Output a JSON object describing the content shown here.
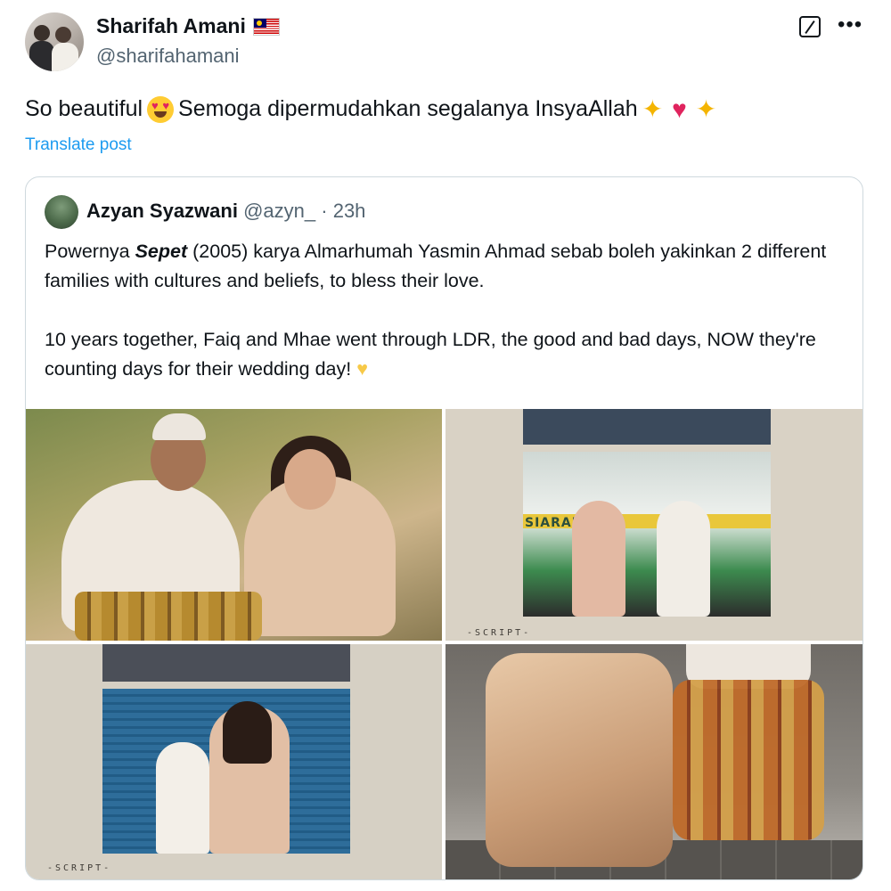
{
  "author": {
    "name": "Sharifah Amani",
    "handle": "@sharifahamani",
    "flag_icon": "malaysia-flag-icon"
  },
  "post": {
    "text_start": "So beautiful",
    "text_end": "Semoga dipermudahkan segalanya InsyaAllah",
    "emojis": [
      "heart-eyes-emoji",
      "sparkles-emoji",
      "red-heart-emoji",
      "sparkles-emoji"
    ],
    "translate_label": "Translate post"
  },
  "quoted": {
    "name": "Azyan Syazwani",
    "handle": "@azyn_",
    "separator": "·",
    "time": "23h",
    "para1_before": "Powernya ",
    "para1_bold": "Sepet",
    "para1_after": " (2005) karya Almarhumah Yasmin Ahmad sebab boleh yakinkan 2 different families with cultures and beliefs, to bless their love.",
    "para2": "10 years together, Faiq and Mhae went through LDR, the good and bad days, NOW they're counting days for their wedding day!",
    "para2_emoji": "yellow-heart-emoji",
    "photos": {
      "photo2_label": "-SCRIPT-",
      "photo2_sign": "SIARAN",
      "photo3_label": "-SCRIPT-"
    }
  },
  "colors": {
    "link": "#1d9bf0",
    "secondary_text": "#536471",
    "border": "#cfd9de"
  }
}
